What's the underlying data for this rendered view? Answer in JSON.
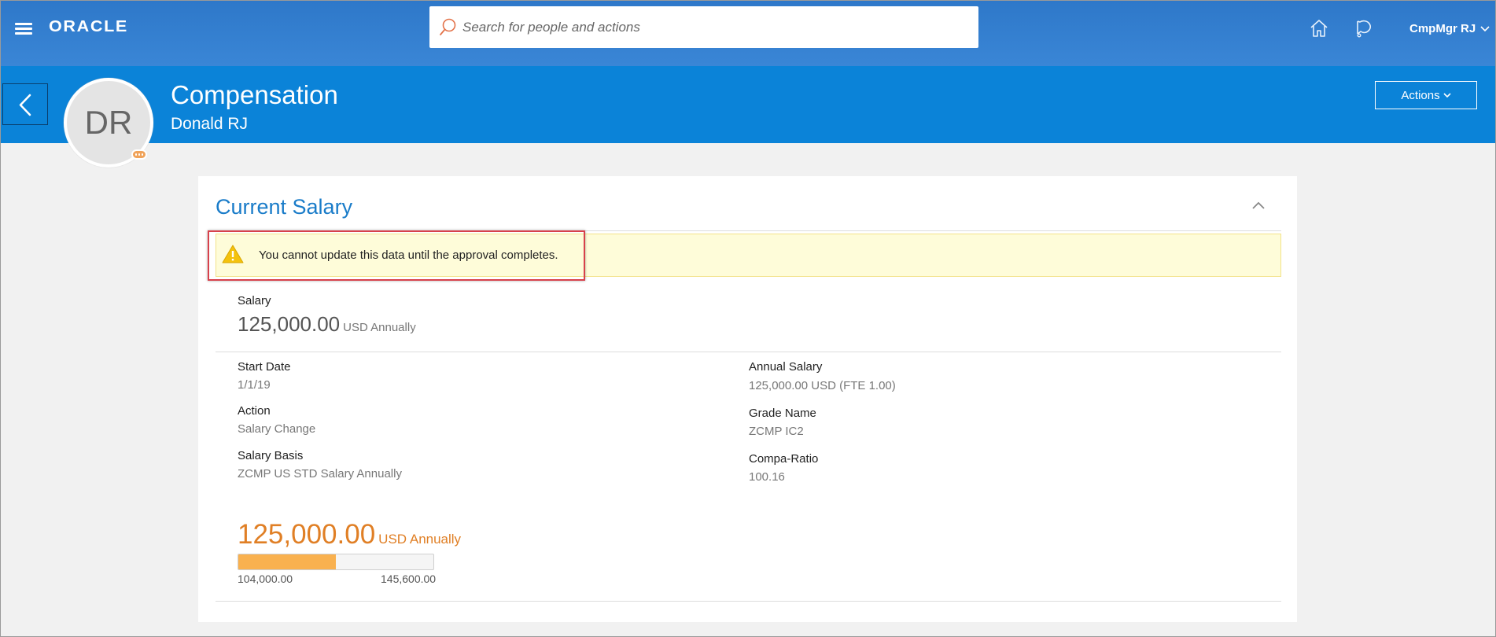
{
  "app": {
    "logo_text": "ORACLE",
    "search_placeholder": "Search for people and actions",
    "user_name": "CmpMgr RJ",
    "icons": {
      "menu": "hamburger-icon",
      "search": "search-icon",
      "home": "home-icon",
      "notifications": "notifications-icon",
      "user_dropdown": "chevron-down-icon"
    }
  },
  "header": {
    "title": "Compensation",
    "subtitle": "Donald RJ",
    "avatar_initials": "DR",
    "actions_label": "Actions"
  },
  "card": {
    "title": "Current Salary",
    "warning": "You cannot update this data until the approval completes.",
    "salary": {
      "label": "Salary",
      "amount": "125,000.00",
      "unit": "USD Annually"
    },
    "fields_left": [
      {
        "label": "Start Date",
        "value": "1/1/19"
      },
      {
        "label": "Action",
        "value": "Salary Change"
      },
      {
        "label": "Salary Basis",
        "value": "ZCMP US STD Salary Annually"
      }
    ],
    "fields_right": [
      {
        "label": "Annual Salary",
        "value": "125,000.00 USD (FTE 1.00)"
      },
      {
        "label": "Grade Name",
        "value": "ZCMP IC2"
      },
      {
        "label": "Compa-Ratio",
        "value": "100.16"
      }
    ],
    "range": {
      "amount": "125,000.00",
      "unit": "USD Annually",
      "min": "104,000.00",
      "max": "145,600.00",
      "fill_fraction": 0.5
    }
  },
  "colors": {
    "topbar": "#3a86d6",
    "header_band": "#0b83d8",
    "card_title": "#1a7cc9",
    "salary_orange": "#e07f25",
    "range_fill": "#f9b14f",
    "warning_bg": "#fefcd9",
    "highlight_border": "#d8414b"
  }
}
